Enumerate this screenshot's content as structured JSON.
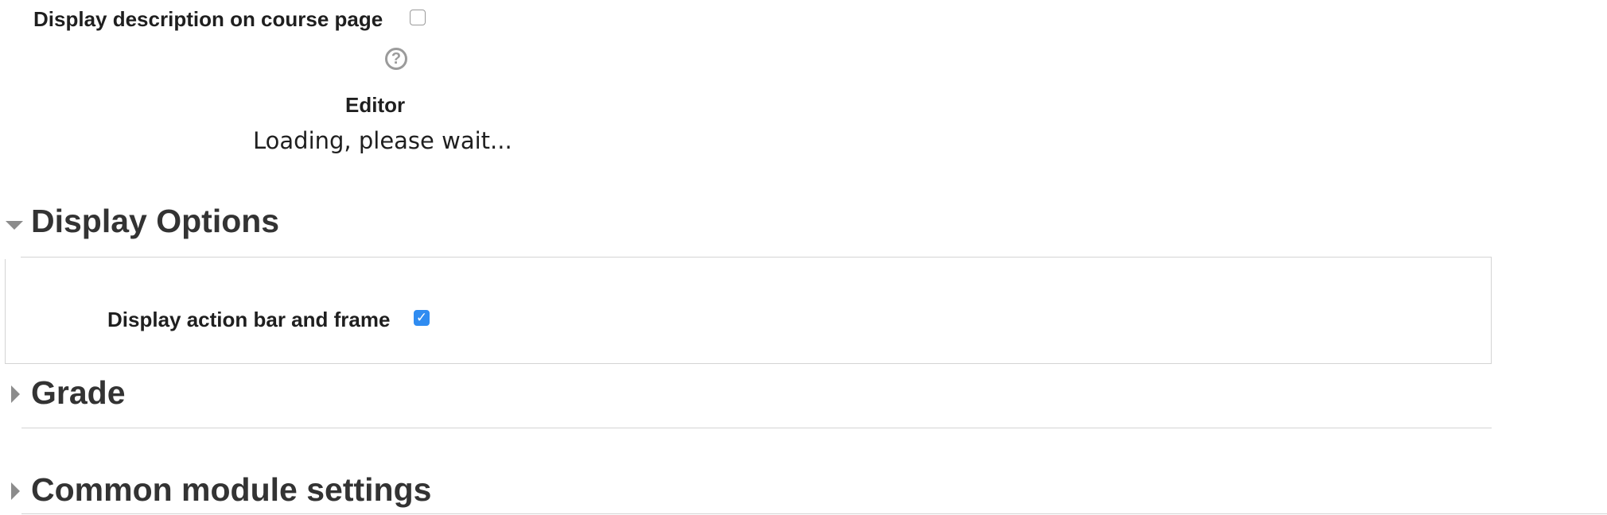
{
  "general": {
    "display_description_label": "Display description on course page",
    "display_description_checked": false,
    "help_icon_glyph": "?",
    "editor_label": "Editor",
    "editor_status": "Loading, please wait..."
  },
  "sections": {
    "display_options": {
      "title": "Display Options",
      "expanded": true,
      "action_bar_label": "Display action bar and frame",
      "action_bar_checked": true,
      "check_glyph": "✓"
    },
    "grade": {
      "title": "Grade",
      "expanded": false
    },
    "common_module_settings": {
      "title": "Common module settings",
      "expanded": false
    }
  },
  "icons": {
    "help": "question-circle-icon",
    "expanded": "triangle-down-icon",
    "collapsed": "triangle-right-icon"
  },
  "colors": {
    "checkbox_accent": "#2f8cf1",
    "border": "#d4d4d4",
    "icon_gray": "#8c8c8c",
    "heading_text": "#333333"
  }
}
